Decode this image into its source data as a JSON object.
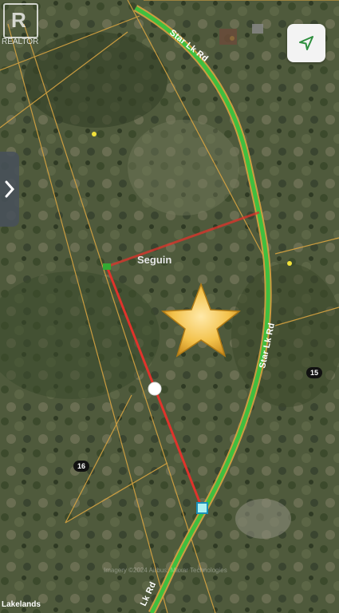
{
  "map": {
    "base_color": "#4a5438",
    "roads": [
      {
        "name": "Star Lk Rd",
        "label": "Star Lk Rd",
        "color": "#3fbf3f"
      }
    ],
    "road_labels": [
      "Star Lk Rd",
      "Star Lk Rd",
      "Lk Rd"
    ],
    "area_label": "Seguin",
    "lot_numbers": [
      "15",
      "16"
    ],
    "measure_line_color": "#e0332b",
    "parcel_line_color": "#d9a441",
    "star_marker": "star-icon",
    "attribution_brand": "Lakelands",
    "attribution_copy": "Imagery ©2024 Airbus, Maxar Technologies"
  },
  "overlay": {
    "logo_letter": "R",
    "logo_word": "REALTOR",
    "locate_button": "navigation-arrow-icon",
    "side_tab_icon": "chevron-right-icon"
  }
}
